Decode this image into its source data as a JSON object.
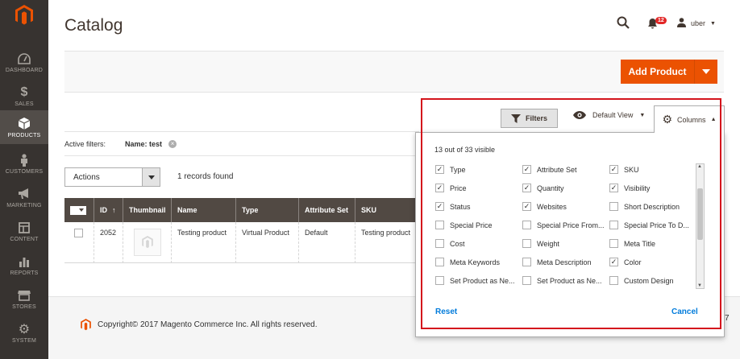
{
  "nav": {
    "items": [
      {
        "label": "DASHBOARD",
        "icon": "dashboard-icon"
      },
      {
        "label": "SALES",
        "icon": "dollar-icon"
      },
      {
        "label": "PRODUCTS",
        "icon": "cube-icon"
      },
      {
        "label": "CUSTOMERS",
        "icon": "person-icon"
      },
      {
        "label": "MARKETING",
        "icon": "megaphone-icon"
      },
      {
        "label": "CONTENT",
        "icon": "layout-icon"
      },
      {
        "label": "REPORTS",
        "icon": "bar-chart-icon"
      },
      {
        "label": "STORES",
        "icon": "storefront-icon"
      },
      {
        "label": "SYSTEM",
        "icon": "gear-icon"
      }
    ]
  },
  "header": {
    "title": "Catalog",
    "notifications_count": "12",
    "user_name": "uber"
  },
  "toolbar": {
    "add_product_label": "Add Product"
  },
  "grid_controls": {
    "filters_label": "Filters",
    "view_label": "Default View",
    "columns_label": "Columns"
  },
  "active_filters": {
    "label": "Active filters:",
    "filter_value": "Name: test"
  },
  "mass_actions": {
    "selected": "Actions",
    "records_found": "1 records found"
  },
  "grid": {
    "columns": [
      "ID",
      "Thumbnail",
      "Name",
      "Type",
      "Attribute Set",
      "SKU"
    ],
    "sort_indicator": "↑",
    "rows": [
      {
        "id": "2052",
        "name": "Testing product",
        "type": "Virtual Product",
        "attribute_set": "Default",
        "sku": "Testing product"
      }
    ]
  },
  "columns_panel": {
    "visible_summary": "13 out of 33 visible",
    "options": [
      {
        "label": "Type",
        "checked": true
      },
      {
        "label": "Attribute Set",
        "checked": true
      },
      {
        "label": "SKU",
        "checked": true
      },
      {
        "label": "Price",
        "checked": true
      },
      {
        "label": "Quantity",
        "checked": true
      },
      {
        "label": "Visibility",
        "checked": true
      },
      {
        "label": "Status",
        "checked": true
      },
      {
        "label": "Websites",
        "checked": true
      },
      {
        "label": "Short Description",
        "checked": false
      },
      {
        "label": "Special Price",
        "checked": false
      },
      {
        "label": "Special Price From...",
        "checked": false
      },
      {
        "label": "Special Price To D...",
        "checked": false
      },
      {
        "label": "Cost",
        "checked": false
      },
      {
        "label": "Weight",
        "checked": false
      },
      {
        "label": "Meta Title",
        "checked": false
      },
      {
        "label": "Meta Keywords",
        "checked": false
      },
      {
        "label": "Meta Description",
        "checked": false
      },
      {
        "label": "Color",
        "checked": true
      },
      {
        "label": "Set Product as Ne...",
        "checked": false
      },
      {
        "label": "Set Product as Ne...",
        "checked": false
      },
      {
        "label": "Custom Design",
        "checked": false
      }
    ],
    "reset_label": "Reset",
    "cancel_label": "Cancel"
  },
  "footer": {
    "copyright": "Copyright© 2017 Magento Commerce Inc. All rights reserved.",
    "version_fragment": "7"
  },
  "colors": {
    "accent": "#eb5202",
    "sidebar": "#373330",
    "grid_header": "#514943",
    "link": "#007bdb",
    "highlight_border": "#d4141c"
  }
}
